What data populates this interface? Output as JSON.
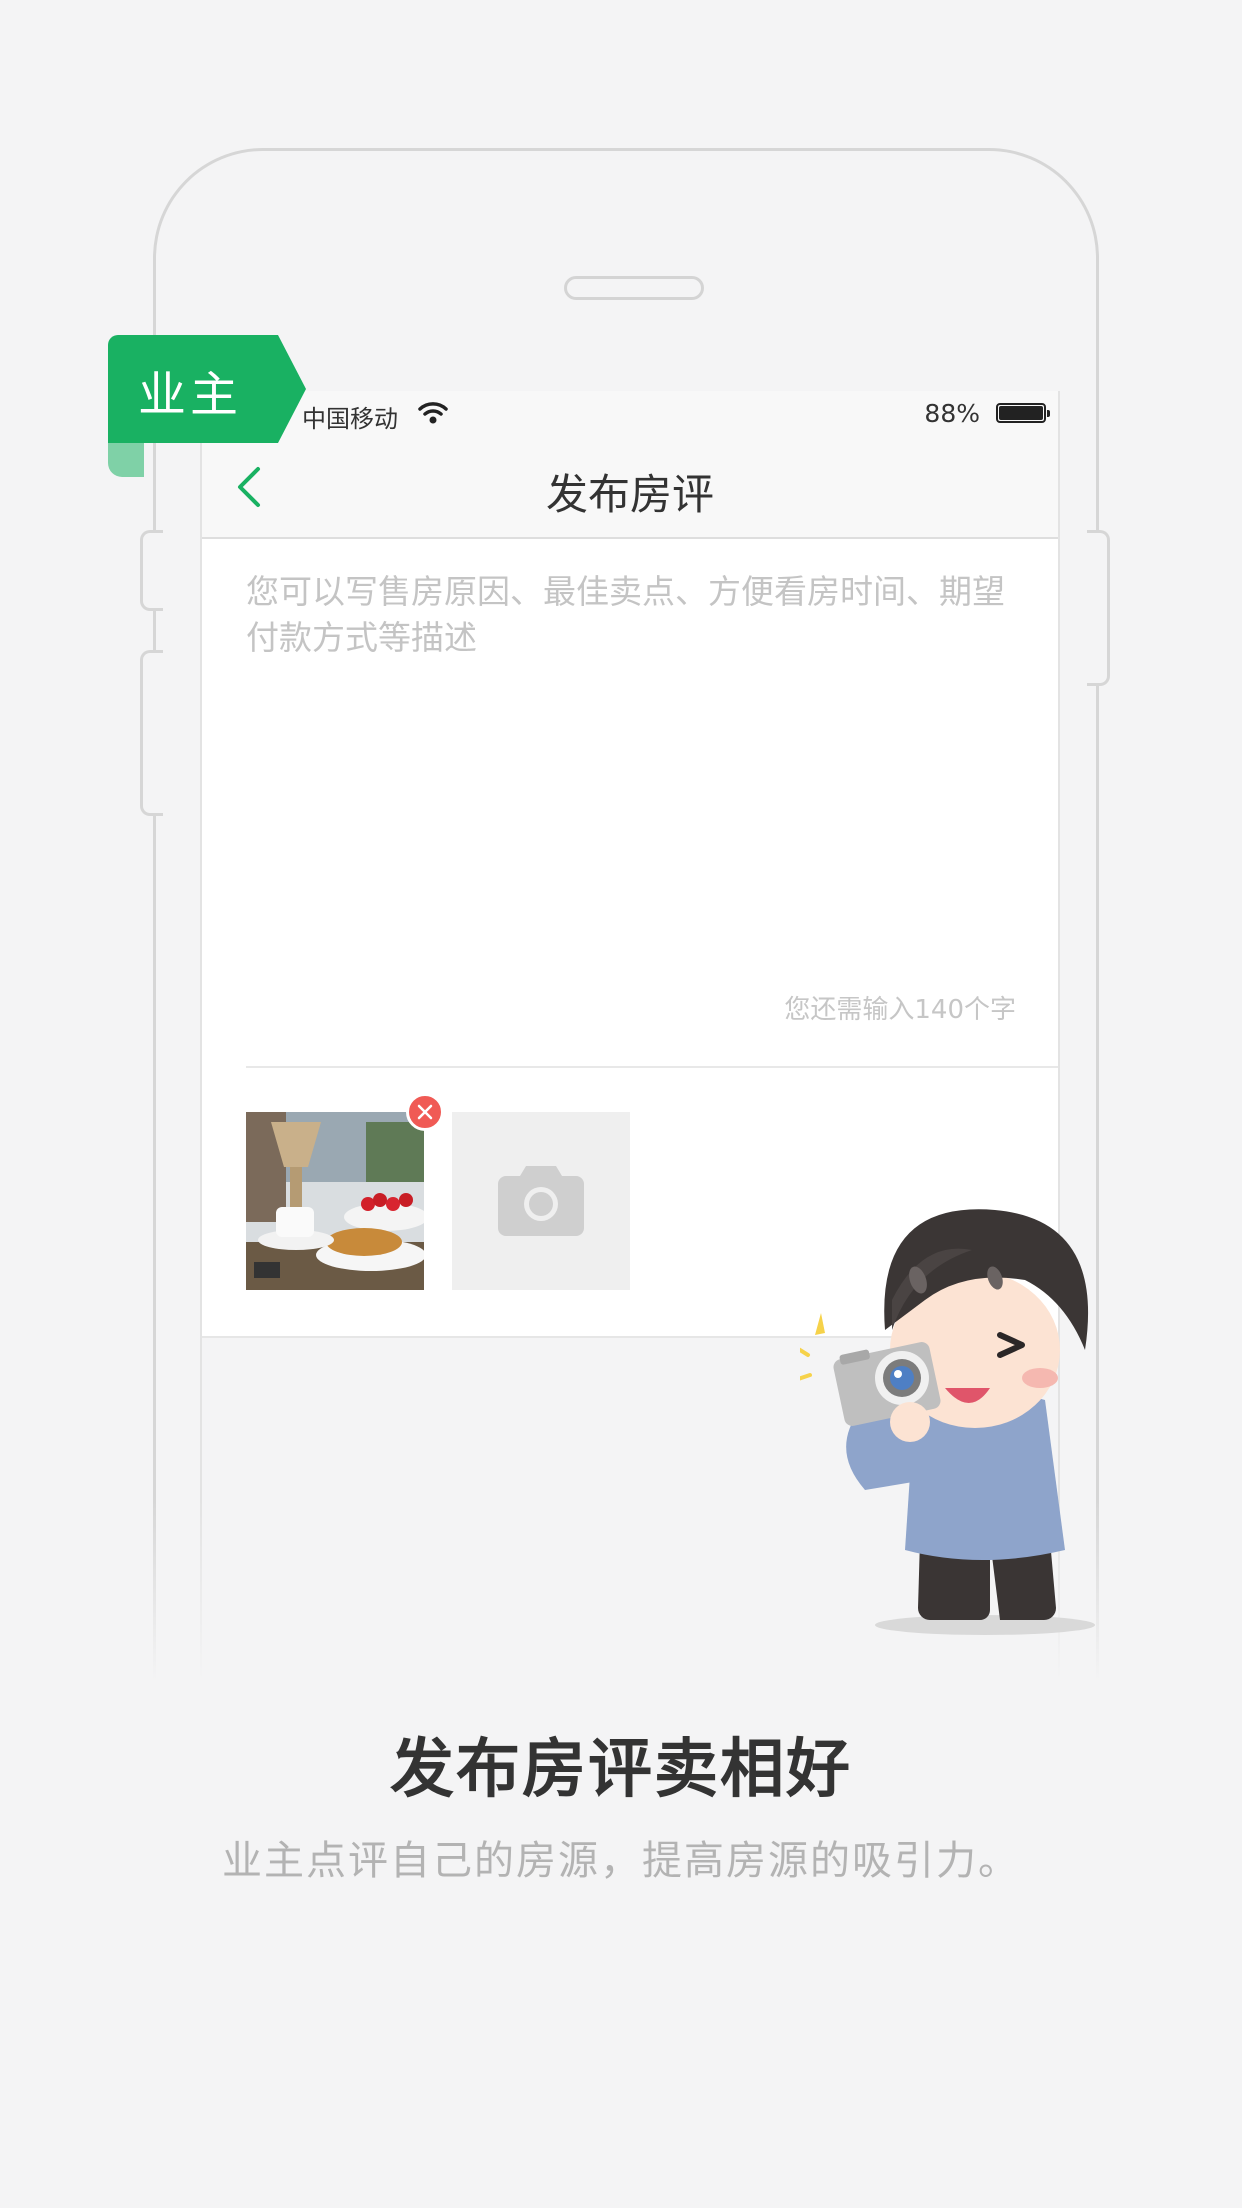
{
  "tag": {
    "label": "业主",
    "color": "#19b162"
  },
  "status_bar": {
    "carrier": "中国移动",
    "battery_percent": "88%"
  },
  "nav": {
    "title": "发布房评",
    "back_icon": "chevron-left-icon"
  },
  "form": {
    "placeholder": "您可以写售房原因、最佳卖点、方便看房时间、期望付款方式等描述",
    "value": "",
    "counter": "您还需输入140个字",
    "add_photo_icon": "camera-icon",
    "remove_icon": "close-icon"
  },
  "promo": {
    "headline": "发布房评卖相好",
    "subline": "业主点评自己的房源，提高房源的吸引力。"
  },
  "colors": {
    "accent": "#19b162",
    "remove": "#f05a55",
    "background": "#f4f4f5"
  }
}
